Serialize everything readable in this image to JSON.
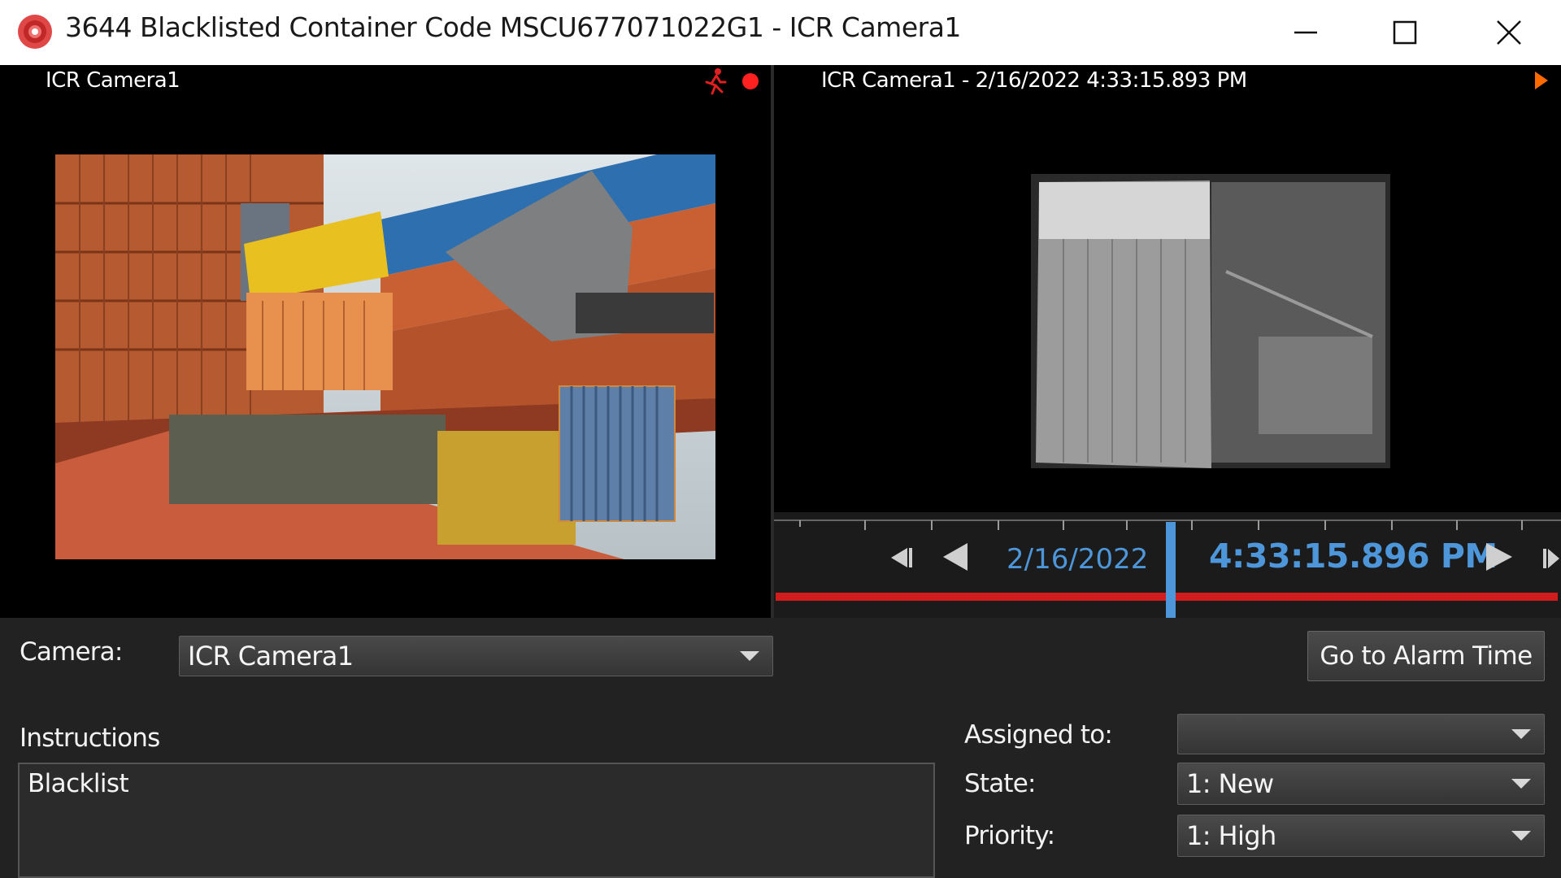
{
  "window": {
    "title": "3644 Blacklisted Container Code MSCU677071022G1 - ICR Camera1",
    "minimize_icon": "minimize-icon",
    "maximize_icon": "maximize-icon",
    "close_icon": "close-icon"
  },
  "live_pane": {
    "title": "ICR Camera1",
    "motion_icon": "running-person-icon",
    "recording_icon": "red-dot-icon"
  },
  "playback_pane": {
    "title": "ICR Camera1 - 2/16/2022 4:33:15.893 PM",
    "play_indicator_icon": "play-arrow-icon"
  },
  "timeline": {
    "date": "2/16/2022",
    "time": "4:33:15.896 PM",
    "icons": [
      "skip-back-icon",
      "step-back-icon",
      "play-icon",
      "skip-forward-icon"
    ]
  },
  "form": {
    "camera_label": "Camera:",
    "camera_value": "ICR Camera1",
    "goto_alarm_button": "Go to Alarm Time",
    "instructions_label": "Instructions",
    "instructions_text": "Blacklist",
    "assigned_label": "Assigned to:",
    "assigned_value": "",
    "state_label": "State:",
    "state_value": "1: New",
    "priority_label": "Priority:",
    "priority_value": "1: High"
  },
  "colors": {
    "accent_blue": "#4c96d9",
    "timeline_red": "#d01c1c",
    "record_red": "#ff2020"
  }
}
